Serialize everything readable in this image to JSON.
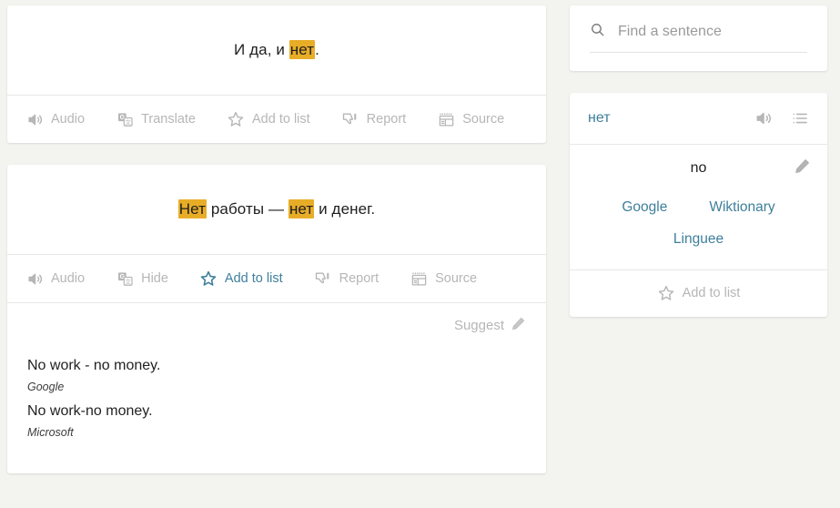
{
  "theme": {
    "page_bg": "#f3f3ef",
    "card_bg": "#ffffff",
    "highlight": "#e8ad27",
    "accent": "#3e7f9b",
    "muted": "#b6b6b6"
  },
  "search": {
    "placeholder": "Find a sentence",
    "value": "",
    "icon": "search-icon"
  },
  "sentences": [
    {
      "parts": [
        {
          "text": "И да, и ",
          "highlight": false
        },
        {
          "text": "нет",
          "highlight": true
        },
        {
          "text": ".",
          "highlight": false
        }
      ],
      "toolbar": [
        {
          "label": "Audio",
          "icon": "speaker-icon",
          "active": false
        },
        {
          "label": "Translate",
          "icon": "translate-icon",
          "active": false
        },
        {
          "label": "Add to list",
          "icon": "star-icon",
          "active": false
        },
        {
          "label": "Report",
          "icon": "thumbs-down-icon",
          "active": false
        },
        {
          "label": "Source",
          "icon": "newspaper-icon",
          "active": false
        }
      ]
    },
    {
      "parts": [
        {
          "text": "Нет",
          "highlight": true
        },
        {
          "text": " работы — ",
          "highlight": false
        },
        {
          "text": "нет",
          "highlight": true
        },
        {
          "text": " и денег.",
          "highlight": false
        }
      ],
      "toolbar": [
        {
          "label": "Audio",
          "icon": "speaker-icon",
          "active": false
        },
        {
          "label": "Hide",
          "icon": "translate-icon",
          "active": false
        },
        {
          "label": "Add to list",
          "icon": "star-icon",
          "active": true
        },
        {
          "label": "Report",
          "icon": "thumbs-down-icon",
          "active": false
        },
        {
          "label": "Source",
          "icon": "newspaper-icon",
          "active": false
        }
      ],
      "translations": {
        "suggest_label": "Suggest",
        "suggest_icon": "pencil-icon",
        "items": [
          {
            "text": "No work - no money.",
            "source": "Google"
          },
          {
            "text": "No work-no money.",
            "source": "Microsoft"
          }
        ]
      }
    }
  ],
  "word_panel": {
    "word": "нет",
    "audio_icon": "speaker-icon",
    "list_icon": "list-icon",
    "definition": "no",
    "edit_icon": "pencil-icon",
    "dictionary_links": [
      {
        "label": "Google"
      },
      {
        "label": "Wiktionary"
      },
      {
        "label": "Linguee"
      }
    ],
    "add_to_list": {
      "label": "Add to list",
      "icon": "star-icon"
    }
  }
}
